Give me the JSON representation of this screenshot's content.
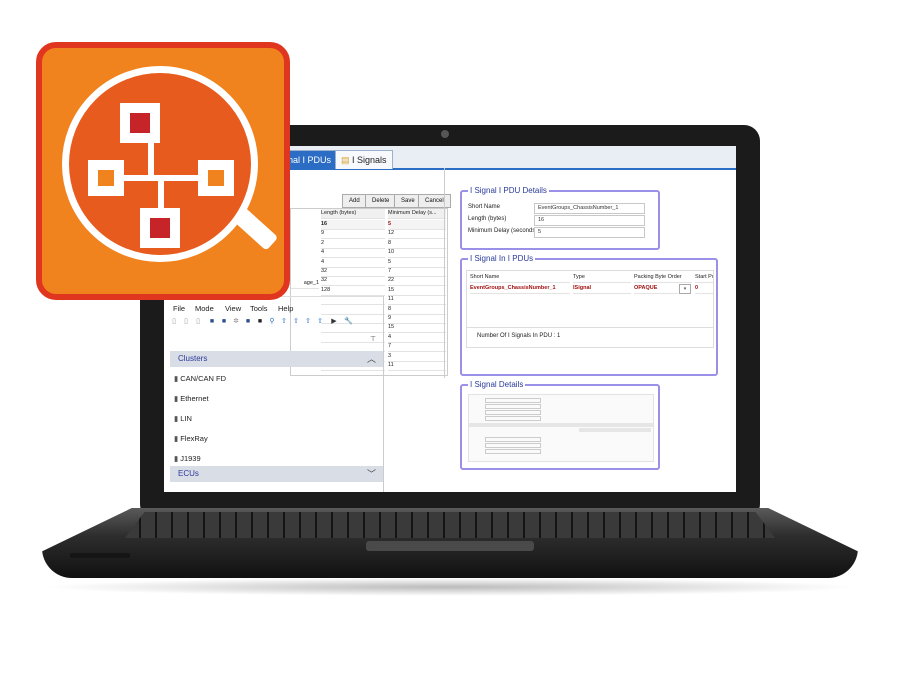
{
  "tabs": [
    {
      "label": "nal I PDUs"
    },
    {
      "label": "I Signals"
    }
  ],
  "toolbar_buttons": [
    "Add",
    "Delete",
    "Save",
    "Cancel"
  ],
  "pdu_table": {
    "headers": [
      "Length (bytes)",
      "Minimum Delay (s..."
    ],
    "rows": [
      [
        "16",
        "5"
      ],
      [
        "9",
        "12"
      ],
      [
        "2",
        "8"
      ],
      [
        "4",
        "10"
      ],
      [
        "4",
        "5"
      ],
      [
        "32",
        "7"
      ],
      [
        "32",
        "22"
      ],
      [
        "128",
        "15"
      ],
      [
        "",
        "11"
      ],
      [
        "",
        "8"
      ],
      [
        "",
        "9"
      ],
      [
        "",
        "15"
      ],
      [
        "",
        "4"
      ],
      [
        "",
        "7"
      ],
      [
        "",
        "3"
      ],
      [
        "",
        "11"
      ]
    ],
    "partial_name": "age_1"
  },
  "menu": [
    "File",
    "Mode",
    "View",
    "Tools",
    "Help"
  ],
  "tree": {
    "clusters_header": "Clusters",
    "clusters": [
      "CAN/CAN FD",
      "Ethernet",
      "LIN",
      "FlexRay",
      "J1939"
    ],
    "ecus_header": "ECUs"
  },
  "pdu_details": {
    "title": "I Signal I PDU Details",
    "short_name_label": "Short Name",
    "short_name_value": "EventGroups_ChassisNumber_1",
    "length_label": "Length (bytes)",
    "length_value": "16",
    "delay_label": "Minimum Delay (seconds)",
    "delay_value": "5"
  },
  "signals_in_pdus": {
    "title": "I Signal In I PDUs",
    "headers": [
      "Short Name",
      "Type",
      "Packing Byte Order",
      "Start Po"
    ],
    "row": [
      "EventGroups_ChassisNumber_1",
      "ISignal",
      "OPAQUE",
      "0"
    ],
    "count_label": "Number Of I Signals In PDU : 1"
  },
  "signal_details": {
    "title": "I Signal Details"
  },
  "colors": {
    "accent": "#2b6cc4",
    "group_border": "#9b90e8",
    "logo_orange": "#f1831f",
    "logo_red": "#e0361f",
    "logo_box_red": "#c7242a"
  }
}
